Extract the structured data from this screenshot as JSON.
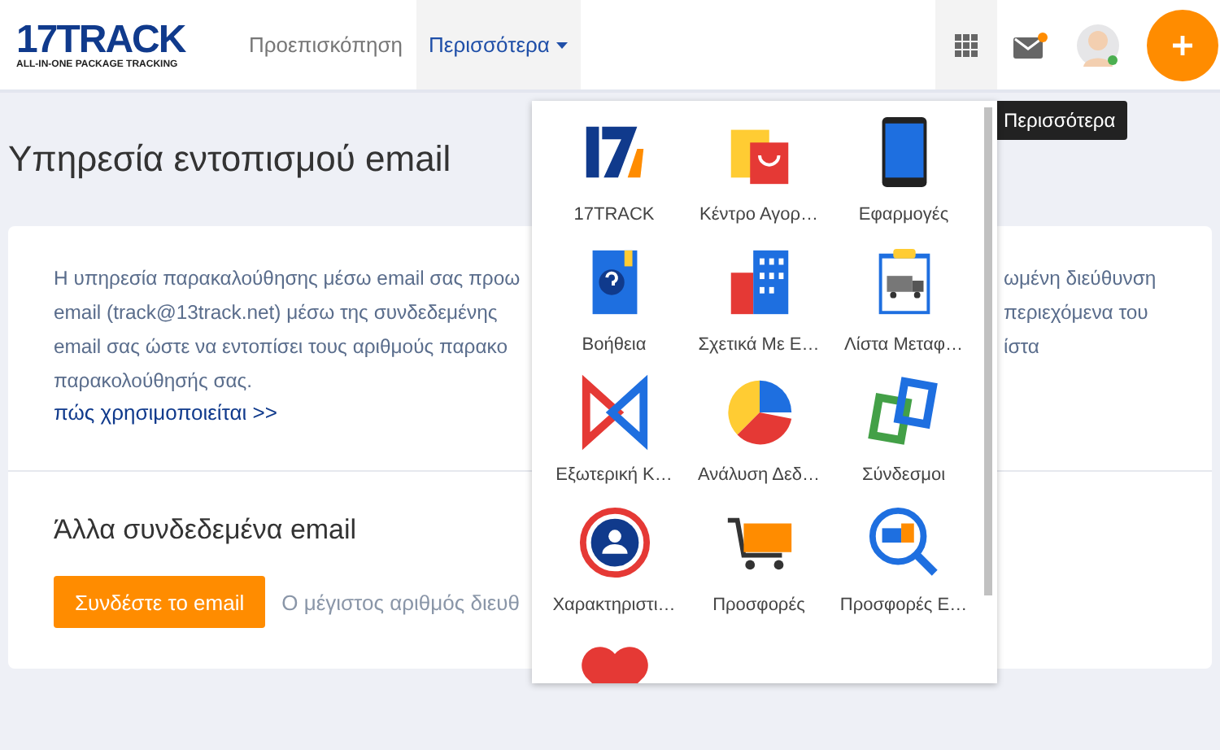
{
  "header": {
    "logo": {
      "brand": "17TRACK",
      "tagline": "ALL-IN-ONE PACKAGE TRACKING"
    },
    "nav": [
      {
        "label": "Προεπισκόπηση",
        "selected": false,
        "dropdown": false
      },
      {
        "label": "Περισσότερα",
        "selected": true,
        "dropdown": true
      }
    ],
    "mail_unread": true,
    "avatar_online": true
  },
  "tooltip": "Περισσότερα",
  "page_title": "Υπηρεσία εντοπισμού email",
  "intro": {
    "left_lines": [
      "Η υπηρεσία παρακαλούθησης μέσω email σας προω",
      "email (track@13track.net) μέσω της συνδεδεμένης",
      "email σας ώστε να εντοπίσει τους αριθμούς παρακο",
      "παρακολούθησής σας."
    ],
    "right_lines": [
      "ωμένη διεύθυνση",
      "περιεχόμενα του",
      "ίστα"
    ],
    "link": "πώς χρησιμοποιείται >>"
  },
  "linked": {
    "title": "Άλλα συνδεδεμένα email",
    "button": "Συνδέστε το email",
    "note": "Ο μέγιστος αριθμός διευθ"
  },
  "apps_menu": [
    {
      "kind": "brand",
      "label": "17TRACK"
    },
    {
      "kind": "bags",
      "label": "Κέντρο Αγορ…"
    },
    {
      "kind": "tablet",
      "label": "Εφαρμογές"
    },
    {
      "kind": "help",
      "label": "Βοήθεια"
    },
    {
      "kind": "building",
      "label": "Σχετικά Με Ε…"
    },
    {
      "kind": "clipboard",
      "label": "Λίστα Μεταφ…"
    },
    {
      "kind": "bowtie",
      "label": "Εξωτερική Κ…"
    },
    {
      "kind": "pie",
      "label": "Ανάλυση Δεδ…"
    },
    {
      "kind": "links",
      "label": "Σύνδεσμοι"
    },
    {
      "kind": "people",
      "label": "Χαρακτηριστι…"
    },
    {
      "kind": "cart",
      "label": "Προσφορές"
    },
    {
      "kind": "magnifier",
      "label": "Προσφορές Ε…"
    },
    {
      "kind": "heart"
    }
  ]
}
